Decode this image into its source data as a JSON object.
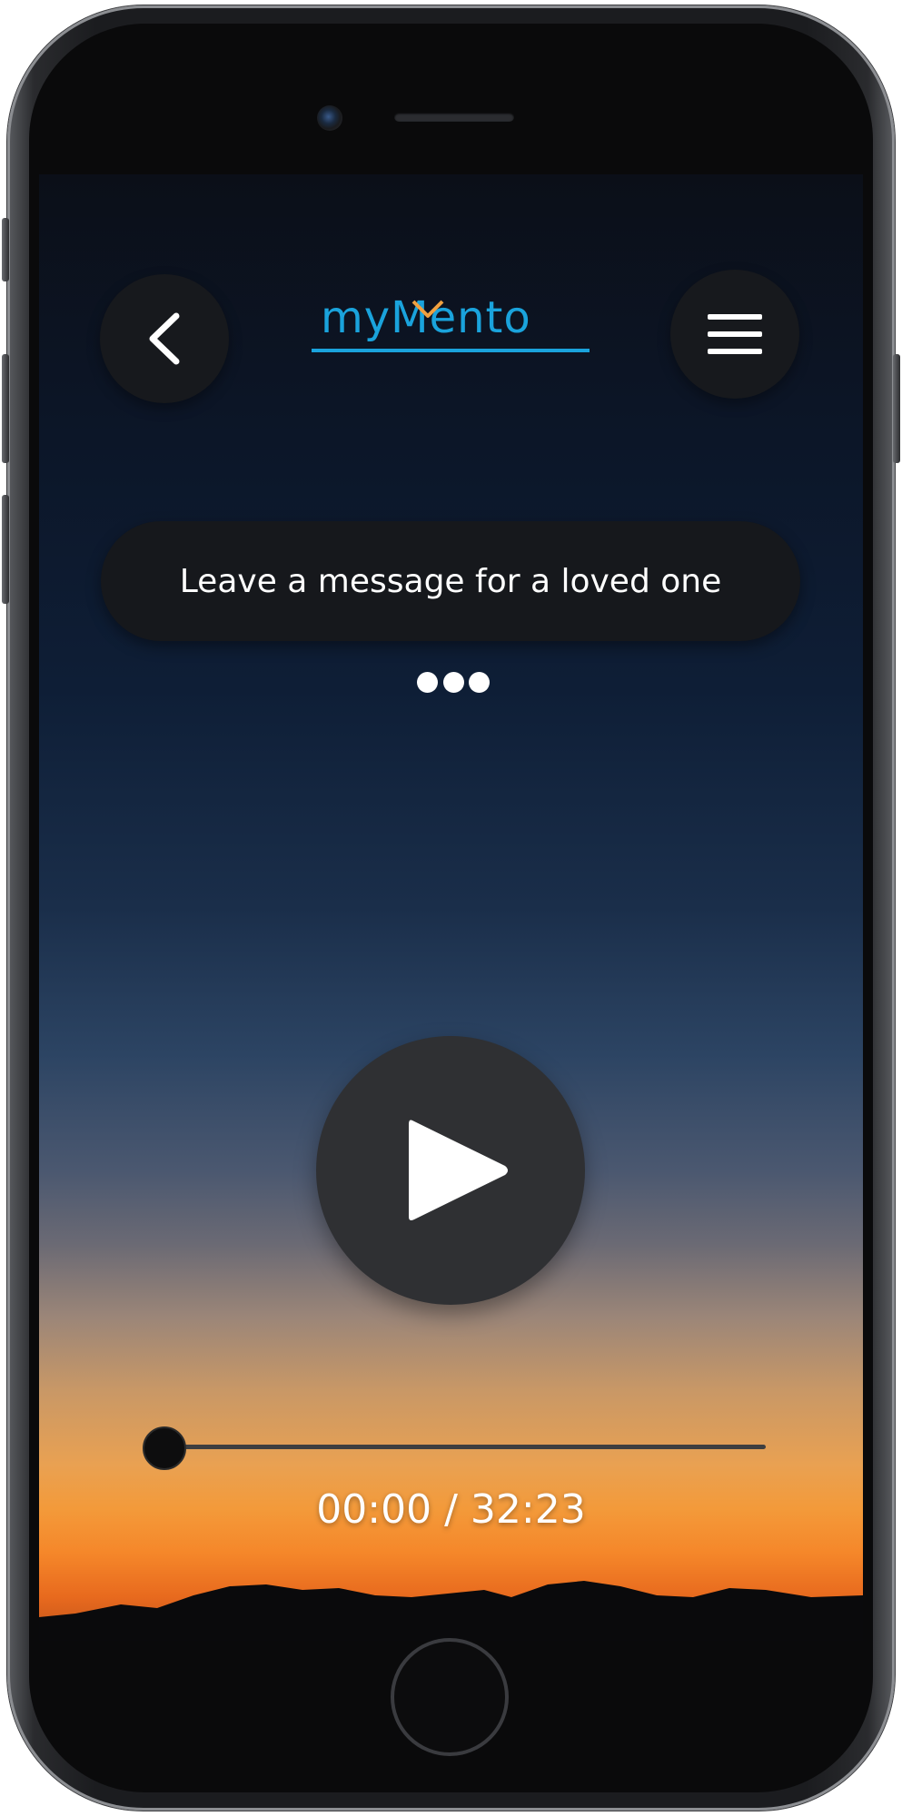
{
  "app": {
    "logo_text": "myMento",
    "brand_color": "#1aa3dc",
    "accent_color": "#f0a040"
  },
  "header": {
    "back_icon": "chevron-left-icon",
    "menu_icon": "hamburger-menu-icon"
  },
  "message": {
    "text": "Leave a message for a loved one"
  },
  "player": {
    "play_icon": "play-icon",
    "current_time": "00:00",
    "total_time": "32:23",
    "time_display": "00:00 / 32:23",
    "progress": 0
  }
}
